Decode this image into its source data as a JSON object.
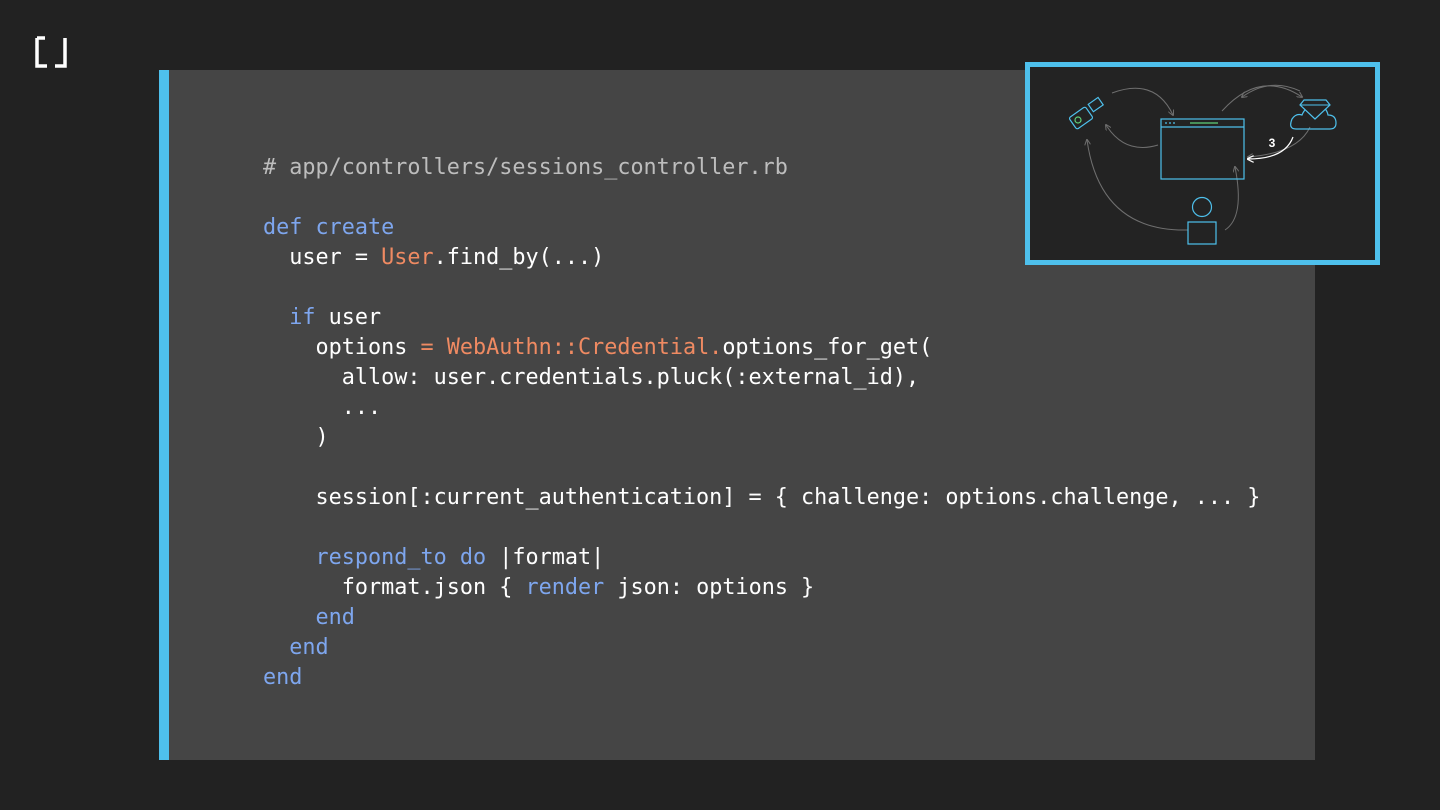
{
  "colors": {
    "background": "#222222",
    "panel": "#454545",
    "accent": "#4ec0ec",
    "comment": "#bdbdbd",
    "text": "#ffffff",
    "keyword": "#7ea6ee",
    "constant": "#ef8a62"
  },
  "logo": {
    "icon": "bracket-logo-icon"
  },
  "code": {
    "lines": [
      [
        {
          "t": "# app/controllers/sessions_controller.rb",
          "c": "comment"
        }
      ],
      [],
      [
        {
          "t": "def create",
          "c": "keyword"
        }
      ],
      [
        {
          "t": "  user = ",
          "c": "plain"
        },
        {
          "t": "User",
          "c": "const"
        },
        {
          "t": ".find_by(...)",
          "c": "plain"
        }
      ],
      [],
      [
        {
          "t": "  if",
          "c": "keyword"
        },
        {
          "t": " user",
          "c": "plain"
        }
      ],
      [
        {
          "t": "    options ",
          "c": "plain"
        },
        {
          "t": "= WebAuthn::Credential.",
          "c": "const"
        },
        {
          "t": "options_for_get(",
          "c": "plain"
        }
      ],
      [
        {
          "t": "      allow: user.credentials.pluck(:external_id),",
          "c": "plain"
        }
      ],
      [
        {
          "t": "      ...",
          "c": "plain"
        }
      ],
      [
        {
          "t": "    )",
          "c": "plain"
        }
      ],
      [],
      [
        {
          "t": "    session[:current_authentication] = { challenge: options.challenge, ... }",
          "c": "plain"
        }
      ],
      [],
      [
        {
          "t": "    respond_to do",
          "c": "keyword"
        },
        {
          "t": " |format|",
          "c": "plain"
        }
      ],
      [
        {
          "t": "      format.json { ",
          "c": "plain"
        },
        {
          "t": "render",
          "c": "keyword"
        },
        {
          "t": " json: options }",
          "c": "plain"
        }
      ],
      [
        {
          "t": "    end",
          "c": "keyword"
        }
      ],
      [
        {
          "t": "  end",
          "c": "keyword"
        }
      ],
      [
        {
          "t": "end",
          "c": "keyword"
        }
      ]
    ]
  },
  "diagram": {
    "step_label": "3",
    "icons": [
      "security-key-icon",
      "browser-window-icon",
      "cloud-gem-icon",
      "user-icon"
    ]
  }
}
